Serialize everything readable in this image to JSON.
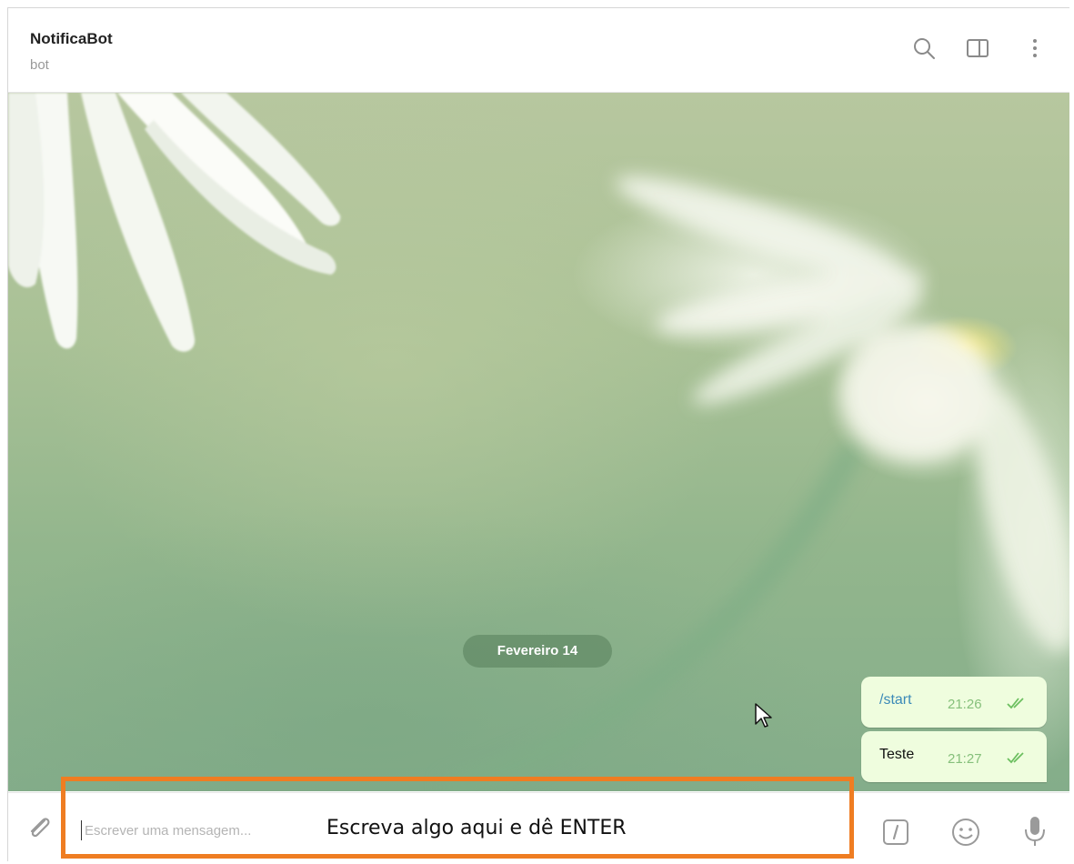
{
  "header": {
    "title": "NotificaBot",
    "status": "bot",
    "icons": [
      "search-icon",
      "sidebar-toggle-icon",
      "more-vertical-icon"
    ]
  },
  "chat": {
    "date_separator": "Fevereiro 14",
    "messages": [
      {
        "text": "/start",
        "time": "21:26",
        "status": "read",
        "is_command": true
      },
      {
        "text": "Teste",
        "time": "21:27",
        "status": "read",
        "is_command": false
      }
    ]
  },
  "composer": {
    "placeholder": "Escrever uma mensagem...",
    "value": "",
    "annotation": "Escreva algo aqui e dê ENTER",
    "icons": [
      "paperclip-icon",
      "slash-command-icon",
      "emoji-icon",
      "microphone-icon"
    ]
  },
  "colors": {
    "highlight": "#ef7d22",
    "bubble_outgoing": "#effdde",
    "command_link": "#3b8ab8",
    "time_text": "#86c07b"
  }
}
